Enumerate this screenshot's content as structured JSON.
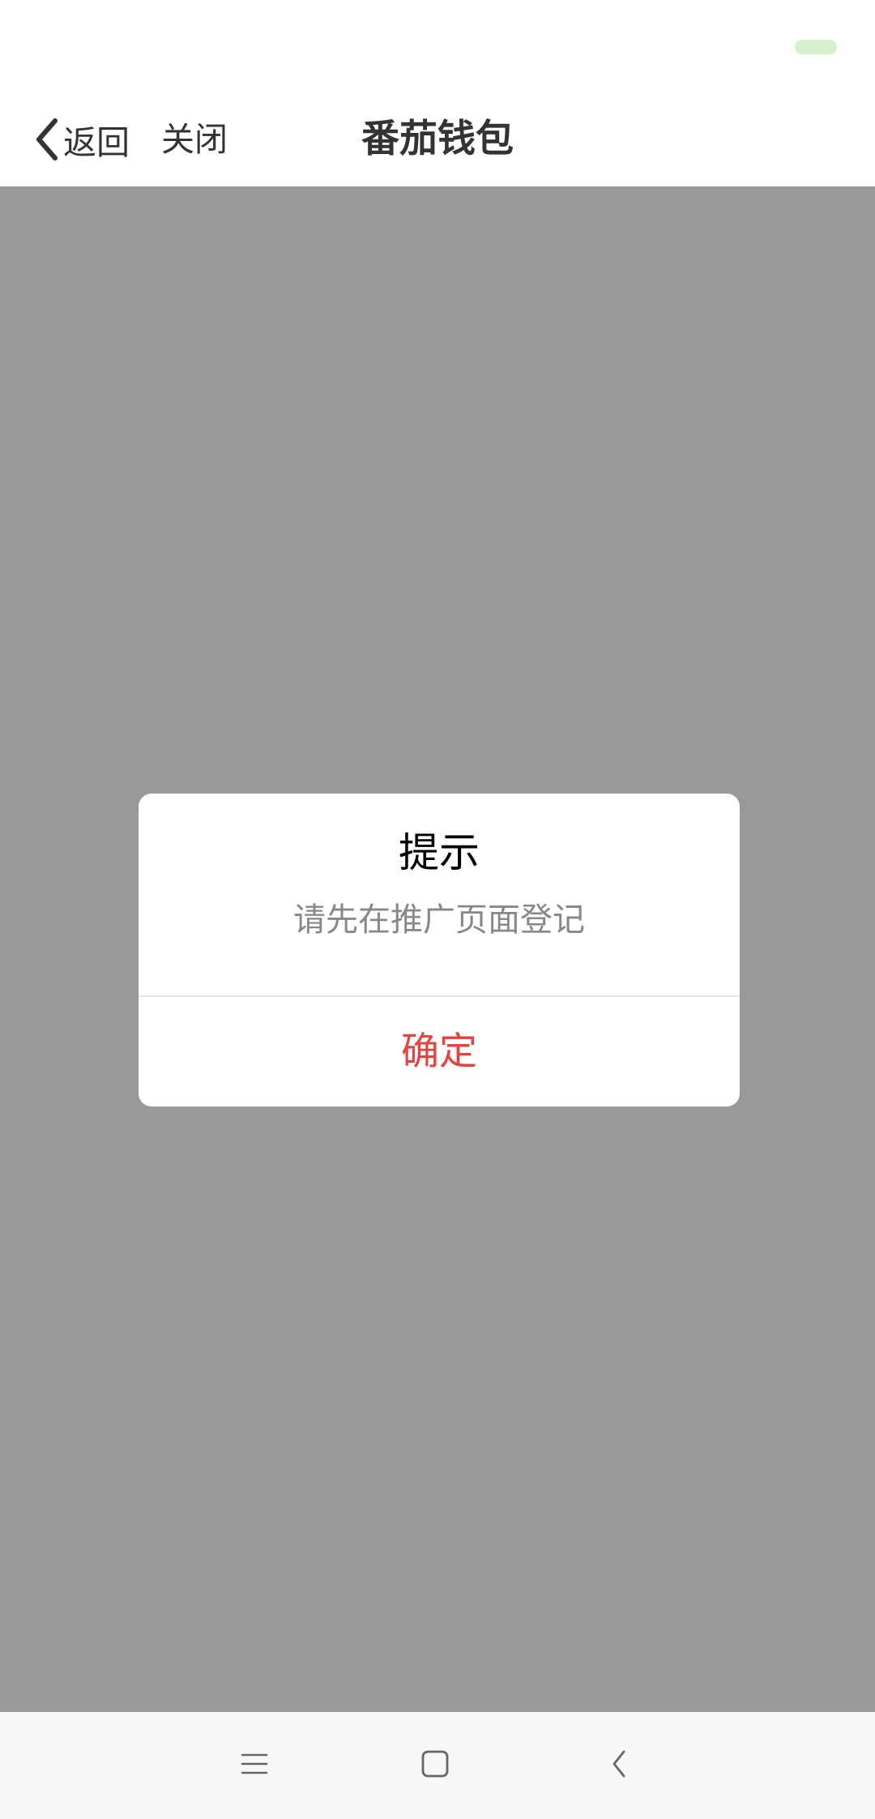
{
  "nav": {
    "back_label": "返回",
    "close_label": "关闭",
    "title": "番茄钱包"
  },
  "dialog": {
    "title": "提示",
    "message": "请先在推广页面登记",
    "confirm_label": "确定"
  },
  "colors": {
    "overlay": "#999999",
    "confirm_text": "#e64340",
    "battery_indicator": "#d6f0cc"
  },
  "system_nav": {
    "buttons": [
      "menu-icon",
      "home-icon",
      "back-icon"
    ]
  }
}
